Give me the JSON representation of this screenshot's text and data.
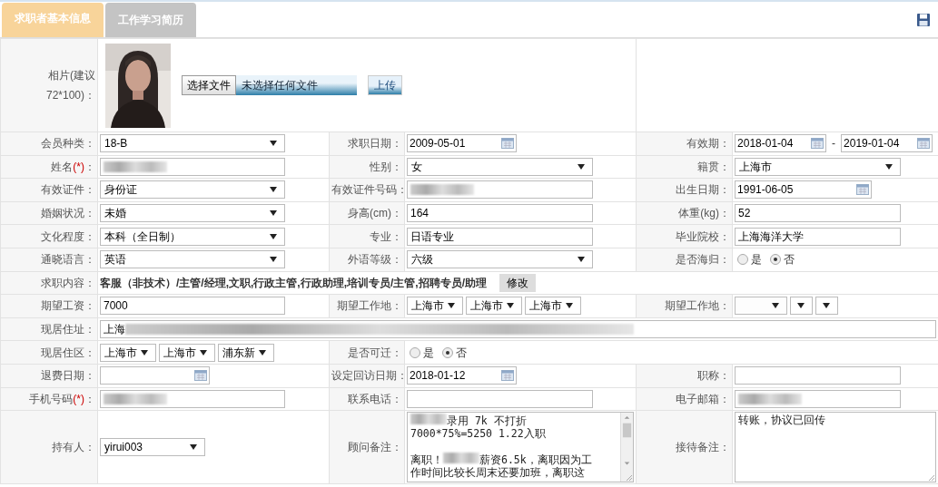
{
  "tabs": [
    {
      "label": "求职者基本信息",
      "selected": true
    },
    {
      "label": "工作学习简历",
      "selected": false
    }
  ],
  "rows": [
    {
      "fields": [
        {
          "label": "相片(建议72*100)：",
          "control": {
            "kind": "photo_upload",
            "choose": "选择文件",
            "filename": "未选择任何文件",
            "upload": "上传"
          }
        }
      ]
    },
    {
      "fields": [
        {
          "label": "会员种类：",
          "control": {
            "kind": "select",
            "value": "18-B"
          }
        },
        {
          "label": "求职日期：",
          "control": {
            "kind": "date",
            "value": "2009-05-01"
          }
        },
        {
          "label": "有效期：",
          "control": {
            "kind": "date_range",
            "from": "2018-01-04",
            "separator": "-",
            "to": "2019-01-04"
          }
        }
      ]
    },
    {
      "fields": [
        {
          "label": "姓名",
          "required_mark": "(*)",
          "label_end": "：",
          "control": {
            "kind": "text",
            "redacted": true
          }
        },
        {
          "label": "性别：",
          "control": {
            "kind": "select",
            "value": "女"
          }
        },
        {
          "label": "籍贯：",
          "control": {
            "kind": "select",
            "value": "上海市"
          }
        }
      ]
    },
    {
      "fields": [
        {
          "label": "有效证件：",
          "control": {
            "kind": "select",
            "value": "身份证"
          }
        },
        {
          "label": "有效证件号码：",
          "control": {
            "kind": "text",
            "redacted": true
          }
        },
        {
          "label": "出生日期：",
          "control": {
            "kind": "date",
            "value": "1991-06-05"
          }
        }
      ]
    },
    {
      "fields": [
        {
          "label": "婚姻状况：",
          "control": {
            "kind": "select",
            "value": "未婚"
          }
        },
        {
          "label": "身高(cm)：",
          "control": {
            "kind": "text",
            "value": "164"
          }
        },
        {
          "label": "体重(kg)：",
          "control": {
            "kind": "text",
            "value": "52"
          }
        }
      ]
    },
    {
      "fields": [
        {
          "label": "文化程度：",
          "control": {
            "kind": "select",
            "value": "本科（全日制）"
          }
        },
        {
          "label": "专业：",
          "control": {
            "kind": "text",
            "value": "日语专业"
          }
        },
        {
          "label": "毕业院校：",
          "control": {
            "kind": "text",
            "value": "上海海洋大学"
          }
        }
      ]
    },
    {
      "fields": [
        {
          "label": "通晓语言：",
          "control": {
            "kind": "select",
            "value": "英语"
          }
        },
        {
          "label": "外语等级：",
          "control": {
            "kind": "select",
            "value": "六级"
          }
        },
        {
          "label": "是否海归：",
          "control": {
            "kind": "radio",
            "options": [
              {
                "label": "是",
                "selected": false
              },
              {
                "label": "否",
                "selected": true
              }
            ]
          }
        }
      ]
    },
    {
      "fields": [
        {
          "label": "求职内容：",
          "control": {
            "kind": "job_choice",
            "text": "客服（非技术）/主管/经理,文职,行政主管,行政助理,培训专员/主管,招聘专员/助理",
            "button": "修改"
          }
        }
      ]
    },
    {
      "fields": [
        {
          "label": "期望工资：",
          "control": {
            "kind": "text",
            "value": "7000"
          }
        },
        {
          "label": "期望工作地：",
          "control": {
            "kind": "select_group",
            "items": [
              {
                "filled": true,
                "value": "上海市"
              },
              {
                "filled": true,
                "value": "上海市"
              },
              {
                "filled": true,
                "value": "上海市"
              }
            ]
          }
        },
        {
          "label": "期望工作地：",
          "control": {
            "kind": "select_group",
            "items": [
              {
                "filled": false
              },
              {
                "filled": false
              },
              {
                "filled": false
              }
            ]
          }
        }
      ]
    },
    {
      "fields": [
        {
          "label": "现居住址：",
          "control": {
            "kind": "text",
            "value": "上海",
            "redacted": true
          }
        }
      ]
    },
    {
      "fields": [
        {
          "label": "现居住区：",
          "control": {
            "kind": "select_group",
            "items": [
              {
                "filled": true,
                "value": "上海市"
              },
              {
                "filled": true,
                "value": "上海市"
              },
              {
                "filled": true,
                "value": "浦东新"
              }
            ]
          }
        },
        {
          "label": "是否可迁：",
          "control": {
            "kind": "radio",
            "options": [
              {
                "label": "是",
                "selected": false
              },
              {
                "label": "否",
                "selected": true
              }
            ]
          }
        }
      ]
    },
    {
      "fields": [
        {
          "label": "退费日期：",
          "control": {
            "kind": "date"
          }
        },
        {
          "label": "设定回访日期：",
          "control": {
            "kind": "date",
            "value": "2018-01-12"
          }
        },
        {
          "label": "职称：",
          "control": {
            "kind": "text"
          }
        }
      ]
    },
    {
      "fields": [
        {
          "label": "手机号码",
          "required_mark": "(*)",
          "label_end": "：",
          "control": {
            "kind": "text",
            "redacted": true
          }
        },
        {
          "label": "联系电话：",
          "control": {
            "kind": "text"
          }
        },
        {
          "label": "电子邮箱：",
          "control": {
            "kind": "text",
            "redacted": true
          }
        }
      ]
    },
    {
      "fields": [
        {
          "label": "持有人：",
          "control": {
            "kind": "select_short",
            "value": "yirui003"
          }
        },
        {
          "label": "顾问备注：",
          "control": {
            "kind": "notes_scroll",
            "lines": [
              {
                "kind": "text",
                "segments": [
                  {
                    "redacted": true
                  },
                  {
                    "text": "录用 7k 不打折"
                  }
                ]
              },
              {
                "kind": "text",
                "segments": [
                  {
                    "text": "7000*75%=5250  1.22入职"
                  }
                ]
              },
              {
                "kind": "gap"
              },
              {
                "kind": "text",
                "segments": [
                  {
                    "text": "离职！"
                  },
                  {
                    "redacted": true
                  },
                  {
                    "text": "薪资6.5k，离职因为工"
                  }
                ]
              },
              {
                "kind": "text",
                "segments": [
                  {
                    "text": "作时间比较长周末还要加班，离职这"
                  }
                ]
              }
            ]
          }
        },
        {
          "label": "接待备注：",
          "control": {
            "kind": "notes",
            "lines": [
              {
                "kind": "text",
                "segments": [
                  {
                    "text": "转账，协议已回传"
                  }
                ]
              }
            ]
          }
        }
      ]
    }
  ]
}
